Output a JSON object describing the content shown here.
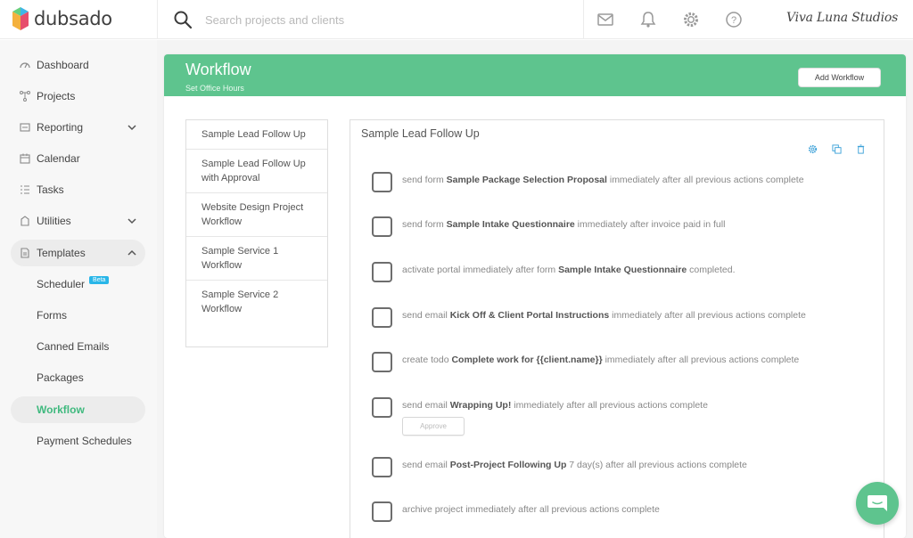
{
  "app": {
    "name": "dubsado"
  },
  "search": {
    "placeholder": "Search projects and clients"
  },
  "header": {
    "icons": [
      "mail-icon",
      "bell-icon",
      "gear-icon",
      "help-icon"
    ],
    "studio_name": "Viva Luna Studios"
  },
  "sidebar": {
    "items": [
      {
        "label": "Dashboard",
        "icon": "dashboard-icon"
      },
      {
        "label": "Projects",
        "icon": "projects-icon"
      },
      {
        "label": "Reporting",
        "icon": "reporting-icon",
        "expandable": true
      },
      {
        "label": "Calendar",
        "icon": "calendar-icon"
      },
      {
        "label": "Tasks",
        "icon": "tasks-icon"
      },
      {
        "label": "Utilities",
        "icon": "utilities-icon",
        "expandable": true
      },
      {
        "label": "Templates",
        "icon": "templates-icon",
        "expanded": true
      }
    ],
    "sub_items": [
      {
        "label": "Scheduler",
        "badge": "Beta"
      },
      {
        "label": "Forms"
      },
      {
        "label": "Canned Emails"
      },
      {
        "label": "Packages"
      },
      {
        "label": "Workflow",
        "selected": true
      },
      {
        "label": "Payment Schedules"
      }
    ]
  },
  "page": {
    "title": "Workflow",
    "subtitle": "Set Office Hours",
    "add_button": "Add Workflow",
    "accent_color": "#5ec48e"
  },
  "workflows": [
    "Sample Lead Follow Up",
    "Sample Lead Follow Up with Approval",
    "Website Design Project Workflow",
    "Sample Service 1 Workflow",
    "Sample Service 2 Workflow"
  ],
  "detail": {
    "title": "Sample Lead Follow Up",
    "tools": [
      "settings-icon",
      "duplicate-icon",
      "trash-icon"
    ],
    "actions": [
      {
        "pre": "send form ",
        "bold": "Sample Package Selection Proposal",
        "post": " immediately after all previous actions complete"
      },
      {
        "pre": "send form ",
        "bold": "Sample Intake Questionnaire",
        "post": " immediately after invoice paid in full"
      },
      {
        "pre": "activate portal immediately after form ",
        "bold": "Sample Intake Questionnaire",
        "post": " completed."
      },
      {
        "pre": "send email ",
        "bold": "Kick Off & Client Portal Instructions",
        "post": " immediately after all previous actions complete"
      },
      {
        "pre": "create todo ",
        "bold": "Complete work for {{client.name}}",
        "post": " immediately after all previous actions complete"
      },
      {
        "pre": "send email ",
        "bold": "Wrapping Up!",
        "post": " immediately after all previous actions complete",
        "approve_label": "Approve"
      },
      {
        "pre": "send email ",
        "bold": "Post-Project Following Up",
        "post": " 7 day(s) after all previous actions complete"
      },
      {
        "pre": "archive project immediately after all previous actions complete",
        "bold": "",
        "post": ""
      }
    ]
  }
}
